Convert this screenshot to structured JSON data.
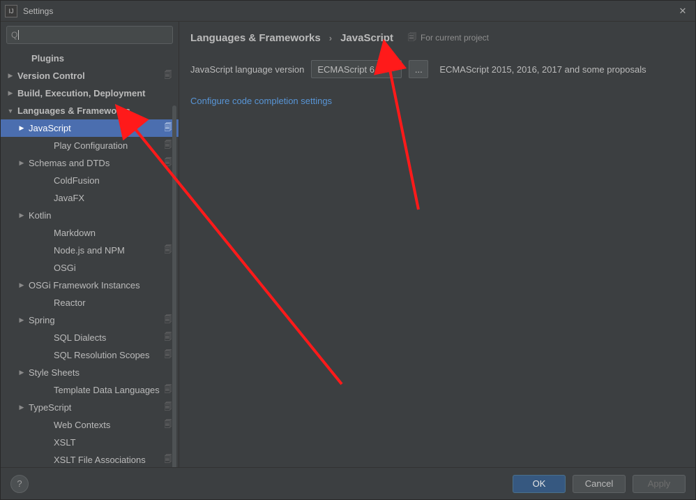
{
  "window": {
    "title": "Settings"
  },
  "search": {
    "placeholder": "Q"
  },
  "header": {
    "breadcrumb": {
      "parent": "Languages & Frameworks",
      "current": "JavaScript"
    },
    "for_project": "For current project"
  },
  "settings": {
    "lang_version_label": "JavaScript language version",
    "lang_version_value": "ECMAScript 6",
    "more_button": "...",
    "lang_version_hint": "ECMAScript 2015, 2016, 2017 and some proposals",
    "configure_link": "Configure code completion settings"
  },
  "footer": {
    "help": "?",
    "ok": "OK",
    "cancel": "Cancel",
    "apply": "Apply"
  },
  "tree": [
    {
      "depth": 0,
      "label": "Plugins",
      "arrow": "",
      "project": false,
      "selected": false,
      "bold": true
    },
    {
      "depth": 0,
      "label": "Version Control",
      "arrow": "right",
      "project": true,
      "selected": false,
      "bold": true
    },
    {
      "depth": 0,
      "label": "Build, Execution, Deployment",
      "arrow": "right",
      "project": false,
      "selected": false,
      "bold": true
    },
    {
      "depth": 0,
      "label": "Languages & Frameworks",
      "arrow": "down",
      "project": false,
      "selected": false,
      "bold": true
    },
    {
      "depth": 1,
      "label": "JavaScript",
      "arrow": "right",
      "project": true,
      "selected": true,
      "bold": false
    },
    {
      "depth": 1,
      "label": "Play Configuration",
      "arrow": "",
      "project": true,
      "selected": false,
      "bold": false
    },
    {
      "depth": 1,
      "label": "Schemas and DTDs",
      "arrow": "right",
      "project": true,
      "selected": false,
      "bold": false
    },
    {
      "depth": 1,
      "label": "ColdFusion",
      "arrow": "",
      "project": false,
      "selected": false,
      "bold": false
    },
    {
      "depth": 1,
      "label": "JavaFX",
      "arrow": "",
      "project": false,
      "selected": false,
      "bold": false
    },
    {
      "depth": 1,
      "label": "Kotlin",
      "arrow": "right",
      "project": false,
      "selected": false,
      "bold": false
    },
    {
      "depth": 1,
      "label": "Markdown",
      "arrow": "",
      "project": false,
      "selected": false,
      "bold": false
    },
    {
      "depth": 1,
      "label": "Node.js and NPM",
      "arrow": "",
      "project": true,
      "selected": false,
      "bold": false
    },
    {
      "depth": 1,
      "label": "OSGi",
      "arrow": "",
      "project": false,
      "selected": false,
      "bold": false
    },
    {
      "depth": 1,
      "label": "OSGi Framework Instances",
      "arrow": "right",
      "project": false,
      "selected": false,
      "bold": false
    },
    {
      "depth": 1,
      "label": "Reactor",
      "arrow": "",
      "project": false,
      "selected": false,
      "bold": false
    },
    {
      "depth": 1,
      "label": "Spring",
      "arrow": "right",
      "project": true,
      "selected": false,
      "bold": false
    },
    {
      "depth": 1,
      "label": "SQL Dialects",
      "arrow": "",
      "project": true,
      "selected": false,
      "bold": false
    },
    {
      "depth": 1,
      "label": "SQL Resolution Scopes",
      "arrow": "",
      "project": true,
      "selected": false,
      "bold": false
    },
    {
      "depth": 1,
      "label": "Style Sheets",
      "arrow": "right",
      "project": false,
      "selected": false,
      "bold": false
    },
    {
      "depth": 1,
      "label": "Template Data Languages",
      "arrow": "",
      "project": true,
      "selected": false,
      "bold": false
    },
    {
      "depth": 1,
      "label": "TypeScript",
      "arrow": "right",
      "project": true,
      "selected": false,
      "bold": false
    },
    {
      "depth": 1,
      "label": "Web Contexts",
      "arrow": "",
      "project": true,
      "selected": false,
      "bold": false
    },
    {
      "depth": 1,
      "label": "XSLT",
      "arrow": "",
      "project": false,
      "selected": false,
      "bold": false
    },
    {
      "depth": 1,
      "label": "XSLT File Associations",
      "arrow": "",
      "project": true,
      "selected": false,
      "bold": false
    }
  ]
}
